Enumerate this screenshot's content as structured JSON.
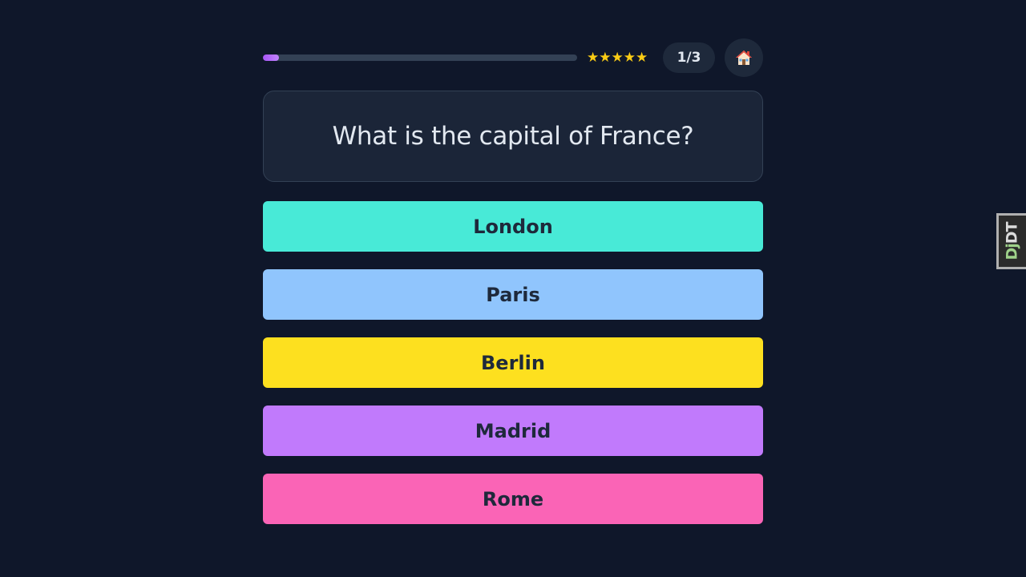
{
  "quiz": {
    "progress": 0.05,
    "stars_text": "★★★★★",
    "counter": "1/3",
    "home_icon": "house-icon",
    "question": "What is the capital of France?",
    "answers": [
      {
        "label": "London",
        "color": "#48ead7"
      },
      {
        "label": "Paris",
        "color": "#90c5fd"
      },
      {
        "label": "Berlin",
        "color": "#fde01f"
      },
      {
        "label": "Madrid",
        "color": "#c17afc"
      },
      {
        "label": "Rome",
        "color": "#fa64b6"
      }
    ]
  },
  "debug_toolbar": {
    "prefix": "Dj",
    "suffix": "DT"
  },
  "colors": {
    "background": "#0f172a",
    "card": "#1b2538",
    "accent": "#a855f7",
    "star": "#facc15"
  }
}
